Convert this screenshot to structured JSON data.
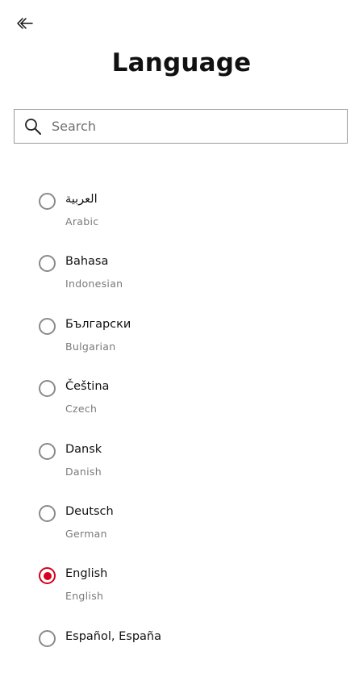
{
  "header": {
    "back_icon": "back-arrow-icon",
    "title": "Language"
  },
  "search": {
    "icon": "search-icon",
    "placeholder": "Search",
    "value": ""
  },
  "accent_color": "#d6001c",
  "languages": [
    {
      "native": "العربية",
      "english": "Arabic",
      "selected": false
    },
    {
      "native": "Bahasa",
      "english": "Indonesian",
      "selected": false
    },
    {
      "native": "Български",
      "english": "Bulgarian",
      "selected": false
    },
    {
      "native": "Čeština",
      "english": "Czech",
      "selected": false
    },
    {
      "native": "Dansk",
      "english": "Danish",
      "selected": false
    },
    {
      "native": "Deutsch",
      "english": "German",
      "selected": false
    },
    {
      "native": "English",
      "english": "English",
      "selected": true
    },
    {
      "native": "Español, España",
      "english": "",
      "selected": false
    }
  ]
}
